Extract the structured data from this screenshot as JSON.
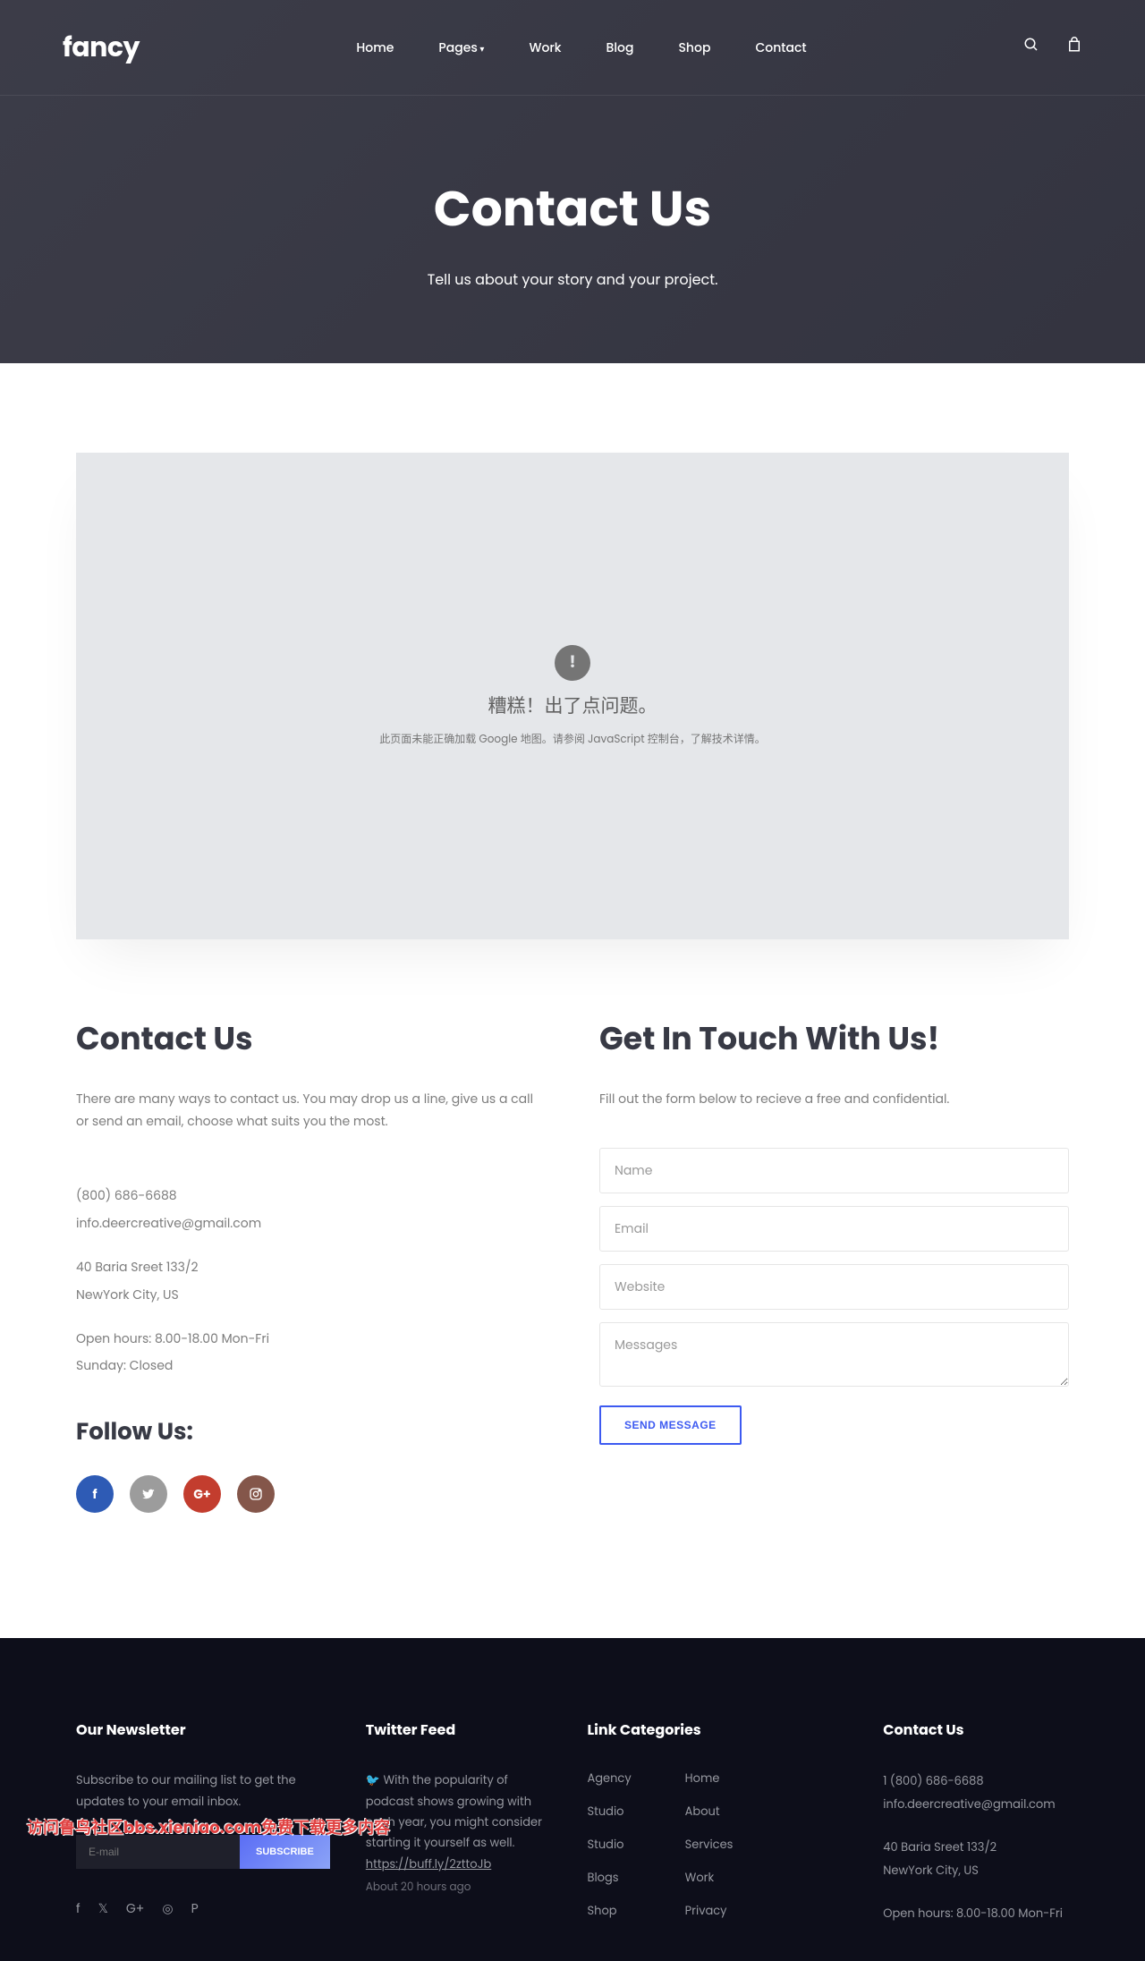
{
  "logo": "fancy",
  "nav": {
    "home": "Home",
    "pages": "Pages",
    "work": "Work",
    "blog": "Blog",
    "shop": "Shop",
    "contact": "Contact"
  },
  "hero": {
    "title": "Contact Us",
    "subtitle": "Tell us about your story and your project."
  },
  "map": {
    "title": "糟糕！出了点问题。",
    "sub": "此页面未能正确加载 Google 地图。请参阅 JavaScript 控制台，了解技术详情。"
  },
  "contact": {
    "heading": "Contact Us",
    "text": "There are many ways to contact us. You may drop us a line, give us a call or send an email, choose what suits you the most.",
    "phone": "(800) 686-6688",
    "email": "info.deercreative@gmail.com",
    "addr1": "40 Baria Sreet 133/2",
    "addr2": "NewYork City, US",
    "hours": "Open hours: 8.00-18.00 Mon-Fri",
    "sunday": "Sunday: Closed",
    "follow": "Follow Us:"
  },
  "form": {
    "heading": "Get In Touch With Us!",
    "text": "Fill out the form below to recieve a free and confidential.",
    "name_ph": "Name",
    "email_ph": "Email",
    "website_ph": "Website",
    "msg_ph": "Messages",
    "send": "SEND MESSAGE"
  },
  "footer": {
    "newsletter": {
      "heading": "Our Newsletter",
      "text": "Subscribe to our mailing list to get the updates to your email inbox.",
      "input_ph": "E-mail",
      "btn": "SUBSCRIBE"
    },
    "twitter": {
      "heading": "Twitter Feed",
      "text": "With the popularity of podcast shows growing with each year, you might consider starting it yourself as well.",
      "link": "https://buff.ly/2zttoJb",
      "time": "About 20 hours ago"
    },
    "links": {
      "heading": "Link Categories",
      "col1": [
        "Agency",
        "Studio",
        "Studio",
        "Blogs",
        "Shop"
      ],
      "col2": [
        "Home",
        "About",
        "Services",
        "Work",
        "Privacy"
      ]
    },
    "contact": {
      "heading": "Contact Us",
      "phone": "1 (800) 686-6688",
      "email": "info.deercreative@gmail.com",
      "addr1": "40 Baria Sreet 133/2",
      "addr2": "NewYork City, US",
      "hours": "Open hours: 8.00-18.00 Mon-Fri"
    }
  },
  "watermark": "访问鲁鸟社区bbs.xieniao.com免费下载更多内容"
}
